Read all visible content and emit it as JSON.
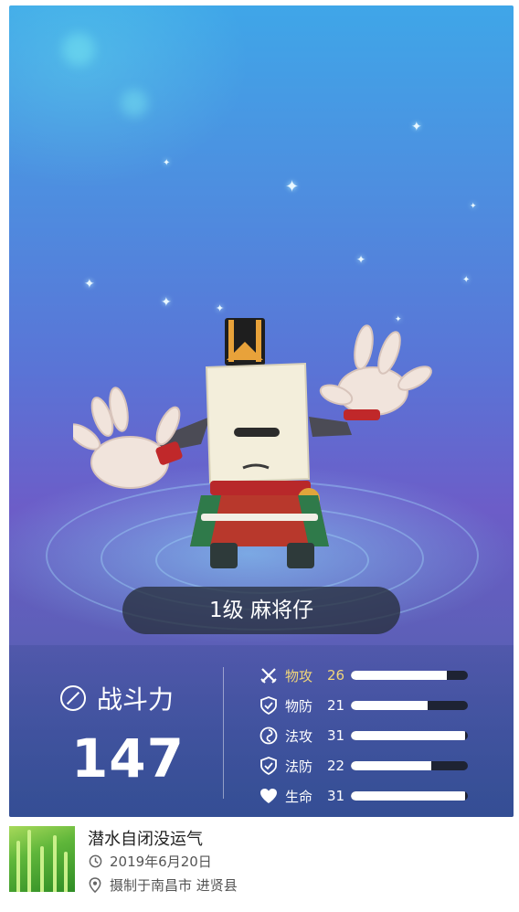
{
  "character": {
    "name_label": "1级 麻将仔"
  },
  "power": {
    "label": "战斗力",
    "value": "147"
  },
  "stats": [
    {
      "icon": "swords-icon",
      "label": "物攻",
      "value": "26",
      "fill": 0.82,
      "highlight": true
    },
    {
      "icon": "shield-icon",
      "label": "物防",
      "value": "21",
      "fill": 0.66,
      "highlight": false
    },
    {
      "icon": "spiral-icon",
      "label": "法攻",
      "value": "31",
      "fill": 0.98,
      "highlight": false
    },
    {
      "icon": "shield-icon",
      "label": "法防",
      "value": "22",
      "fill": 0.69,
      "highlight": false
    },
    {
      "icon": "heart-icon",
      "label": "生命",
      "value": "31",
      "fill": 0.98,
      "highlight": false
    }
  ],
  "footer": {
    "user_name": "潜水自闭没运气",
    "date": "2019年6月20日",
    "location": "摄制于南昌市 进贤县"
  }
}
